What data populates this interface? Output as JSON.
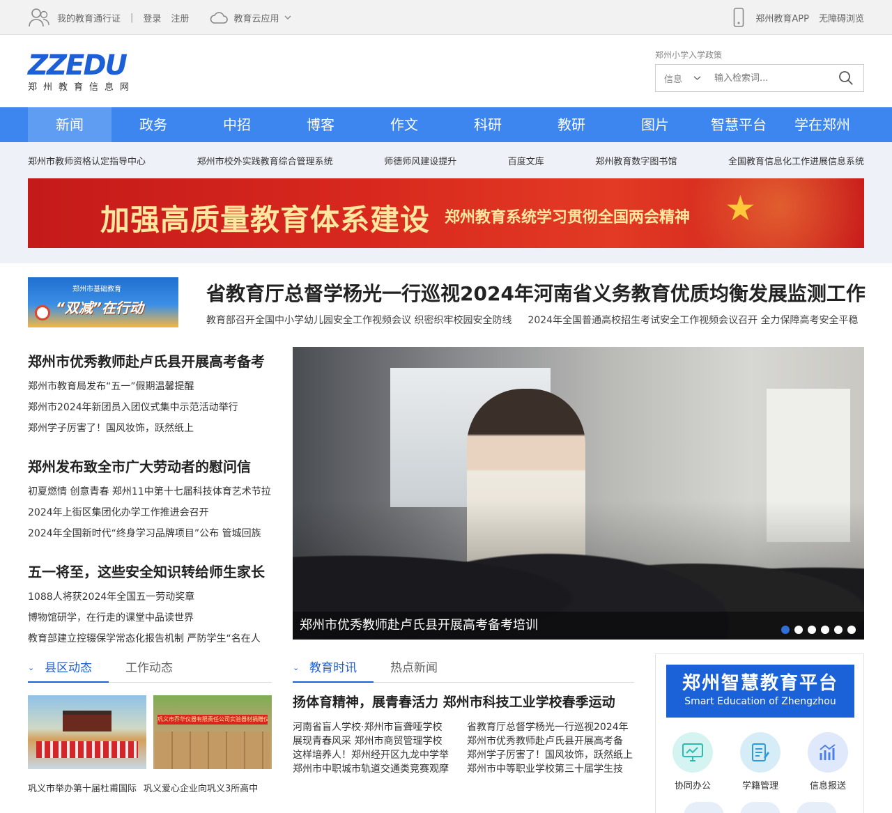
{
  "topbar": {
    "passport": "我的教育通行证",
    "login": "登录",
    "register": "注册",
    "cloud_apps": "教育云应用",
    "app": "郑州教育APP",
    "accessible": "无障碍浏览"
  },
  "logo": {
    "main": "ZZEDU",
    "sub": "郑州教育信息网"
  },
  "search": {
    "hint": "郑州小学入学政策",
    "type": "信息",
    "placeholder": "输入检索词..."
  },
  "nav": {
    "items": [
      "新闻",
      "政务",
      "中招",
      "博客",
      "作文",
      "科研",
      "教研",
      "图片",
      "智慧平台",
      "学在郑州"
    ],
    "active": "新闻"
  },
  "quick_links": [
    "郑州市教师资格认定指导中心",
    "郑州市校外实践教育综合管理系统",
    "师德师风建设提升",
    "百度文库",
    "郑州教育数字图书馆",
    "全国教育信息化工作进展信息系统"
  ],
  "banner": {
    "main": "加强高质量教育体系建设",
    "sub": "郑州教育系统学习贯彻全国两会精神"
  },
  "headline": {
    "image_small": "郑州市基础教育",
    "image_text": "“双减”在行动",
    "title": "省教育厅总督学杨光一行巡视2024年河南省义务教育优质均衡发展监测工作",
    "subs": [
      "教育部召开全国中小学幼儿园安全工作视频会议 织密织牢校园安全防线",
      "2024年全国普通高校招生考试安全工作视频会议召开 全力保障高考安全平稳"
    ]
  },
  "news_groups": [
    {
      "title": "郑州市优秀教师赴卢氏县开展高考备考",
      "items": [
        "郑州市教育局发布“五一”假期温馨提醒",
        "郑州市2024年新团员入团仪式集中示范活动举行",
        "郑州学子厉害了！国风妆饰，跃然纸上"
      ]
    },
    {
      "title": "郑州发布致全市广大劳动者的慰问信",
      "items": [
        "初夏燃情 创意青春 郑州11中第十七届科技体育艺术节拉",
        "2024年上街区集团化办学工作推进会召开",
        "2024年全国新时代“终身学习品牌项目”公布 管城回族"
      ]
    },
    {
      "title": "五一将至，这些安全知识转给师生家长",
      "items": [
        "1088人将获2024年全国五一劳动奖章",
        "博物馆研学，在行走的课堂中品读世界",
        "教育部建立控辍保学常态化报告机制 严防学生“名在人"
      ]
    }
  ],
  "slider": {
    "caption": "郑州市优秀教师赴卢氏县开展高考备考培训",
    "dots": 6,
    "active_index": 0
  },
  "county": {
    "tabs": [
      "县区动态",
      "工作动态"
    ],
    "active": "县区动态",
    "image2_banner": "巩义市乔华仪器有限责任公司实验器材捐赠仪式",
    "captions": [
      "巩义市举办第十届杜甫国际",
      "巩义爱心企业向巩义3所高中"
    ]
  },
  "edu_news": {
    "tabs": [
      "教育时讯",
      "热点新闻"
    ],
    "active": "教育时讯",
    "title": "扬体育精神，展青春活力 郑州市科技工业学校春季运动",
    "items": [
      "河南省盲人学校·郑州市盲聋哑学校",
      "省教育厅总督学杨光一行巡视2024年",
      "展现青春风采 郑州市商贸管理学校",
      "郑州市优秀教师赴卢氏县开展高考备",
      "这样培养人！郑州经开区九龙中学举",
      "郑州学子厉害了！国风妆饰，跃然纸上",
      "郑州市中职城市轨道交通类竞赛观摩",
      "郑州市中等职业学校第三十届学生技"
    ]
  },
  "smart": {
    "title_cn": "郑州智慧教育平台",
    "title_en": "Smart Education of Zhengzhou",
    "apps": [
      "协同办公",
      "学籍管理",
      "信息报送"
    ]
  },
  "colors": {
    "nav_blue": "#3d86f0",
    "brand_blue": "#1d5fd6",
    "banner_red": "#d8281e"
  }
}
